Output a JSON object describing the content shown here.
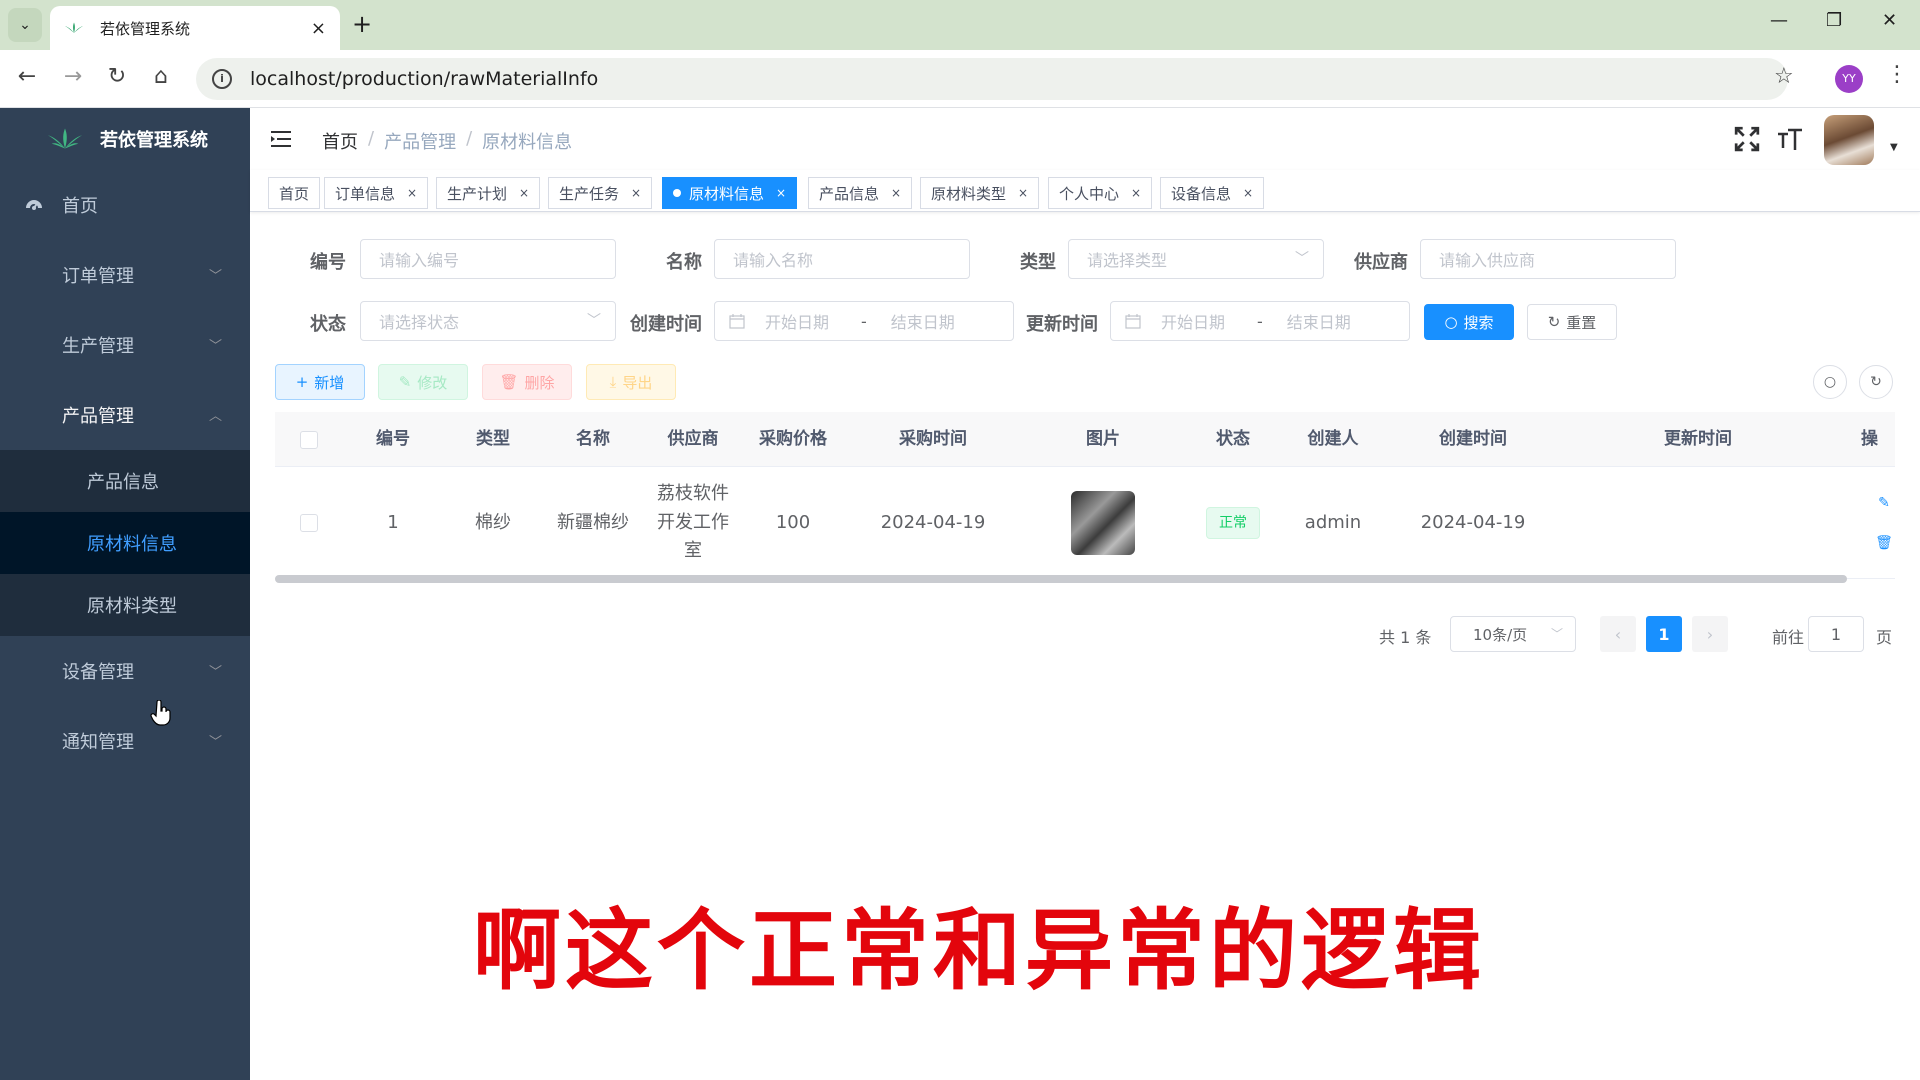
{
  "browser": {
    "tab_title": "若依管理系统",
    "url": "localhost/production/rawMaterialInfo",
    "profile_initials": "YY"
  },
  "sidebar": {
    "brand": "若依管理系统",
    "items": [
      {
        "label": "首页"
      },
      {
        "label": "订单管理"
      },
      {
        "label": "生产管理"
      },
      {
        "label": "产品管理",
        "children": [
          "产品信息",
          "原材料信息",
          "原材料类型"
        ]
      },
      {
        "label": "设备管理"
      },
      {
        "label": "通知管理"
      }
    ],
    "active_child": "原材料信息"
  },
  "navbar": {
    "breadcrumb": [
      "首页",
      "产品管理",
      "原材料信息"
    ]
  },
  "tags": [
    "首页",
    "订单信息",
    "生产计划",
    "生产任务",
    "原材料信息",
    "产品信息",
    "原材料类型",
    "个人中心",
    "设备信息"
  ],
  "active_tag": "原材料信息",
  "search_form": {
    "code_label": "编号",
    "code_placeholder": "请输入编号",
    "name_label": "名称",
    "name_placeholder": "请输入名称",
    "type_label": "类型",
    "type_placeholder": "请选择类型",
    "supplier_label": "供应商",
    "supplier_placeholder": "请输入供应商",
    "status_label": "状态",
    "status_placeholder": "请选择状态",
    "created_label": "创建时间",
    "updated_label": "更新时间",
    "start_placeholder": "开始日期",
    "end_placeholder": "结束日期",
    "range_sep": "-",
    "search_btn": "搜索",
    "reset_btn": "重置"
  },
  "toolbar": {
    "add": "新增",
    "edit": "修改",
    "delete": "删除",
    "export": "导出"
  },
  "table": {
    "columns": [
      "编号",
      "类型",
      "名称",
      "供应商",
      "采购价格",
      "采购时间",
      "图片",
      "状态",
      "创建人",
      "创建时间",
      "更新时间",
      "操"
    ],
    "rows": [
      {
        "code": "1",
        "type": "棉纱",
        "name": "新疆棉纱",
        "supplier": "荔枝软件开发工作室",
        "price": "100",
        "purchase_time": "2024-04-19",
        "status": "正常",
        "creator": "admin",
        "create_time": "2024-04-19",
        "update_time": ""
      }
    ]
  },
  "pagination": {
    "total": "共 1 条",
    "page_size": "10条/页",
    "current_page": "1",
    "goto_label": "前往",
    "goto_value": "1",
    "page_suffix": "页"
  },
  "caption": "啊这个正常和异常的逻辑"
}
